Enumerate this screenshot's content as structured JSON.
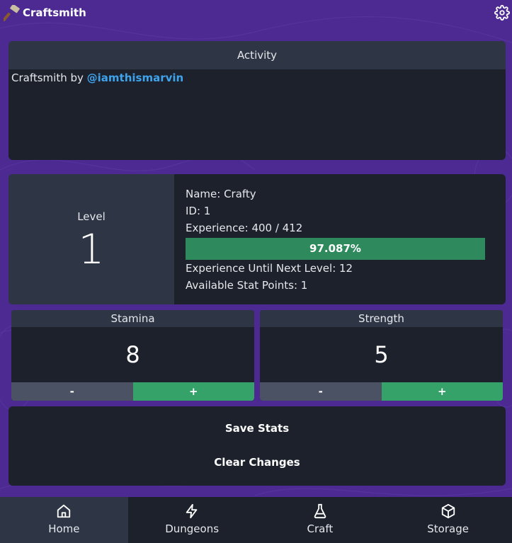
{
  "app": {
    "title": "Craftsmith"
  },
  "activity": {
    "header": "Activity",
    "message_prefix": "Craftsmith by ",
    "message_link": "@iamthismarvin"
  },
  "character": {
    "level_label": "Level",
    "level_value": "1",
    "name_line": "Name: Crafty",
    "id_line": "ID: 1",
    "experience_line": "Experience: 400 / 412",
    "xp_percent_text": "97.087%",
    "xp_fraction": 0.97087,
    "xp_until_next_line": "Experience Until Next Level: 12",
    "stat_points_line": "Available Stat Points: 1"
  },
  "stats": {
    "stamina": {
      "label": "Stamina",
      "value": "8",
      "minus": "-",
      "plus": "+"
    },
    "strength": {
      "label": "Strength",
      "value": "5",
      "minus": "-",
      "plus": "+"
    }
  },
  "actions": {
    "save": "Save Stats",
    "clear": "Clear Changes"
  },
  "nav": {
    "home": "Home",
    "dungeons": "Dungeons",
    "craft": "Craft",
    "storage": "Storage"
  },
  "icons": {
    "logo": "hammer-icon",
    "settings": "gear-icon",
    "home": "home-icon",
    "dungeons": "lightning-icon",
    "craft": "flask-icon",
    "storage": "cube-icon"
  },
  "colors": {
    "background": "#4c2a92",
    "panel": "#1c212c",
    "panel_header": "#2e3646",
    "accent_green": "#35a26a",
    "progress_green": "#2e8a5c",
    "link_blue": "#3fa3ec"
  }
}
